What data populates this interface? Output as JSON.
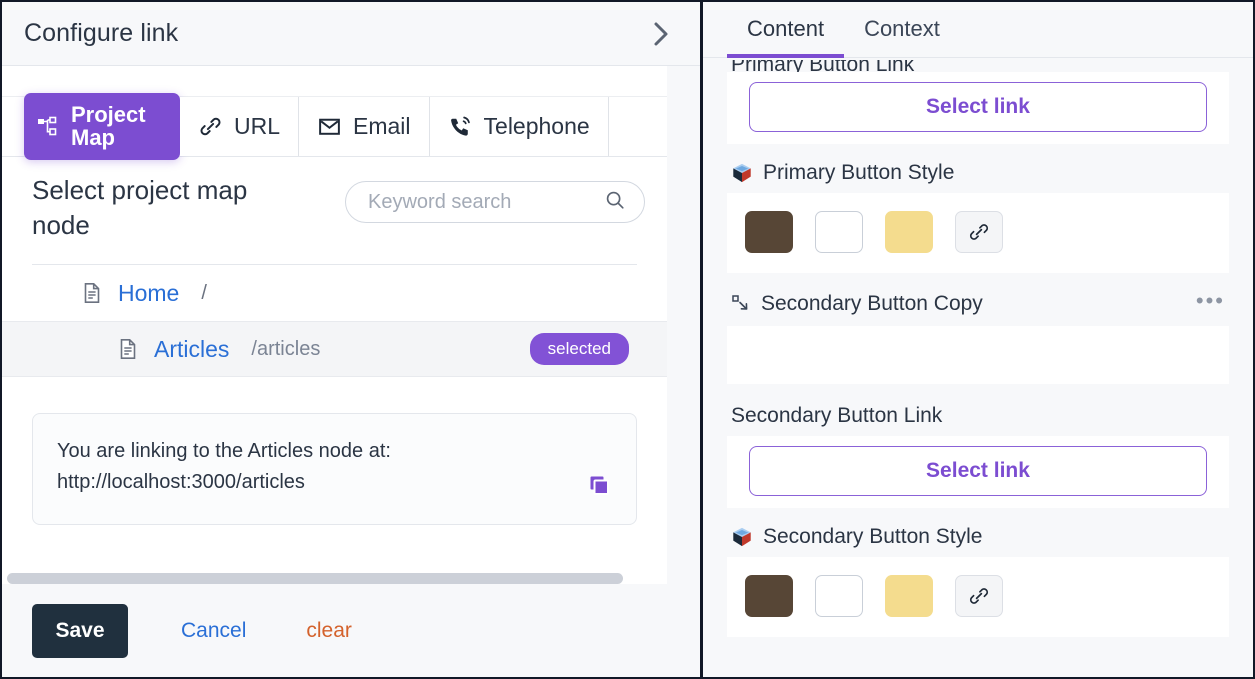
{
  "left_panel": {
    "title": "Configure link",
    "collapse_icon": "chevron-right-icon",
    "tabs": [
      {
        "label": "Project Map",
        "icon": "sitemap-icon",
        "active": true
      },
      {
        "label": "URL",
        "icon": "link-icon",
        "active": false
      },
      {
        "label": "Email",
        "icon": "envelope-icon",
        "active": false
      },
      {
        "label": "Telephone",
        "icon": "phone-icon",
        "active": false
      }
    ],
    "select_heading": "Select project map node",
    "search": {
      "placeholder": "Keyword search",
      "value": "",
      "icon": "search-icon"
    },
    "tree": [
      {
        "name": "Home",
        "slug": "",
        "separator": "/",
        "icon": "document-icon",
        "selected": false,
        "depth": 1
      },
      {
        "name": "Articles",
        "slug": "/articles",
        "separator": "",
        "icon": "document-icon",
        "selected": true,
        "badge": "selected",
        "depth": 2
      }
    ],
    "info": {
      "line1": "You are linking to the Articles node at:",
      "line2": "http://localhost:3000/articles",
      "copy_icon": "copy-icon"
    },
    "footer": {
      "save_label": "Save",
      "cancel_label": "Cancel",
      "clear_label": "clear"
    }
  },
  "right_panel": {
    "tabs": [
      {
        "label": "Content",
        "active": true
      },
      {
        "label": "Context",
        "active": false
      }
    ],
    "clipped_label": "Primary Button Link",
    "fields": [
      {
        "label": "",
        "button_label": "Select link"
      }
    ],
    "primary_button_style": {
      "label": "Primary Button Style",
      "icon": "cube-icon",
      "swatches": [
        {
          "name": "brown-swatch",
          "color": "#574636"
        },
        {
          "name": "white-swatch",
          "color": "#ffffff"
        },
        {
          "name": "yellow-swatch",
          "color": "#f4dc8e"
        },
        {
          "name": "link-swatch",
          "color": "#f4f5f7",
          "icon": "link-icon"
        }
      ]
    },
    "secondary_button_copy": {
      "label": "Secondary Button Copy",
      "icon": "corner-arrow-icon",
      "menu_icon": "ellipsis-icon",
      "value": ""
    },
    "secondary_button_link": {
      "label": "Secondary Button Link",
      "button_label": "Select link"
    },
    "secondary_button_style": {
      "label": "Secondary Button Style",
      "icon": "cube-icon",
      "swatches": [
        {
          "name": "brown-swatch",
          "color": "#574636"
        },
        {
          "name": "white-swatch",
          "color": "#ffffff"
        },
        {
          "name": "yellow-swatch",
          "color": "#f4dc8e"
        },
        {
          "name": "link-swatch",
          "color": "#f4f5f7",
          "icon": "link-icon"
        }
      ]
    }
  },
  "colors": {
    "accent_purple": "#7c4dd1",
    "badge_purple": "#8252d6",
    "link_blue": "#2a6fd6",
    "clear_orange": "#d4622c",
    "save_dark": "#20303e"
  }
}
